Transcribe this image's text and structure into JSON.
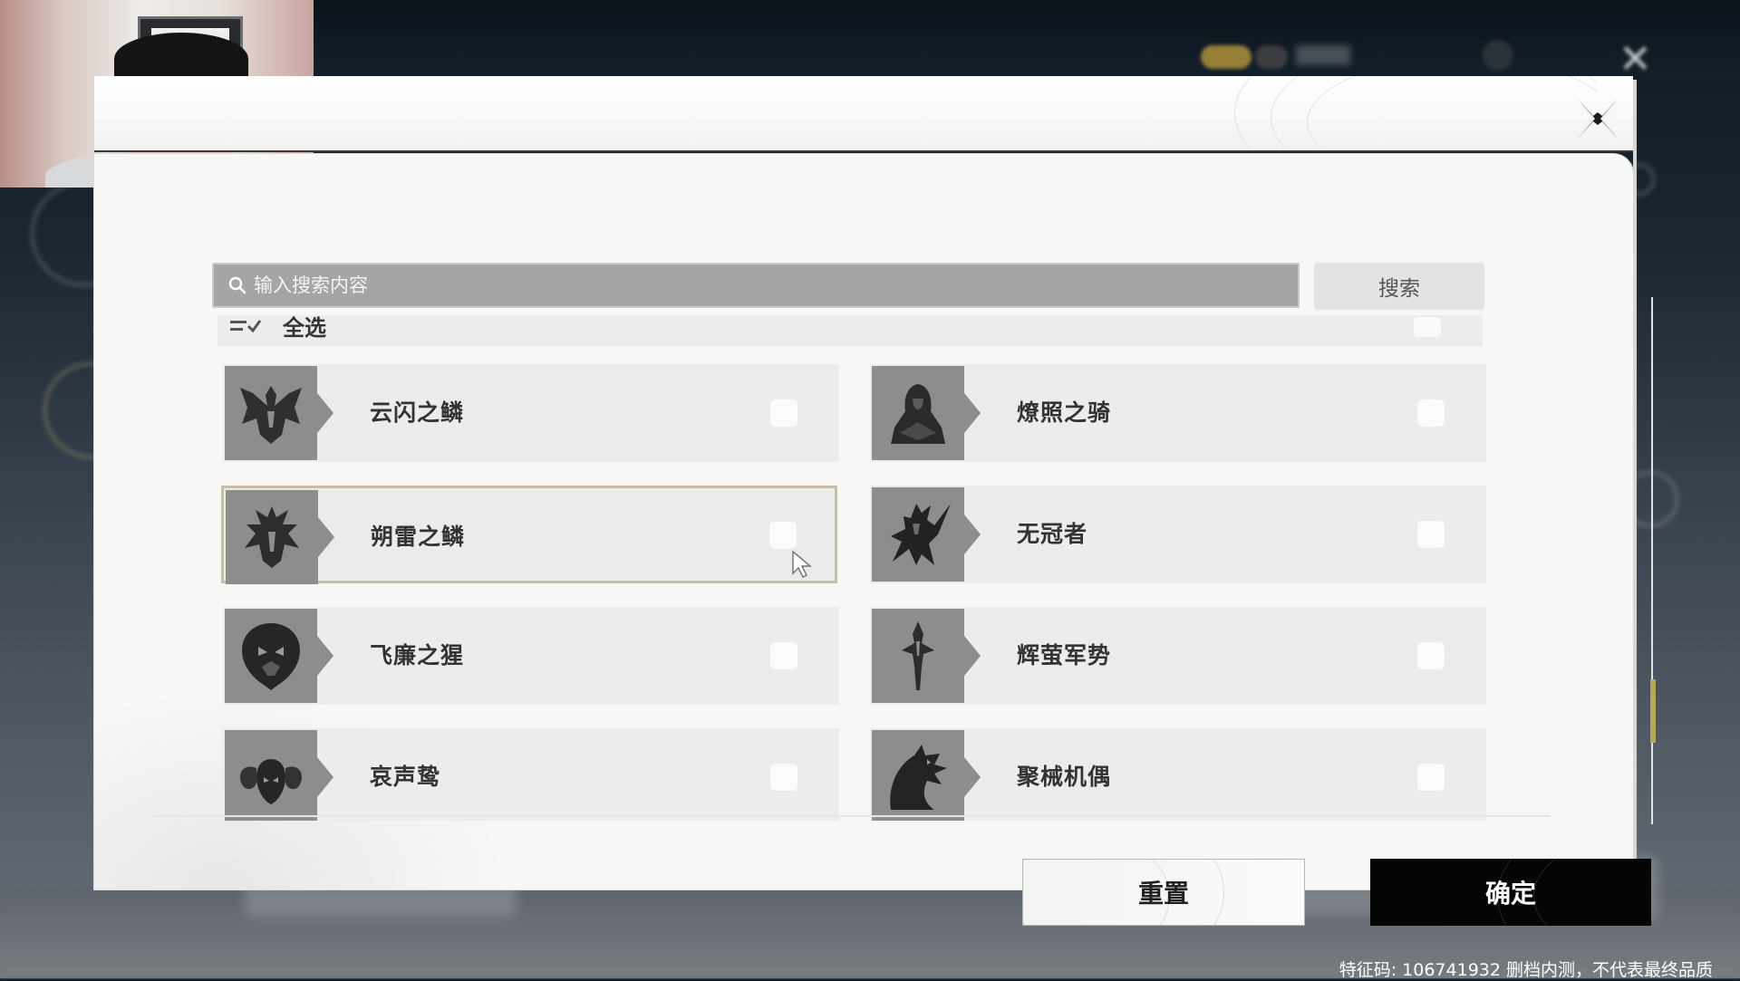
{
  "search": {
    "placeholder": "输入搜索内容",
    "button_label": "搜索"
  },
  "list": {
    "select_all_label": "全选",
    "items": [
      {
        "name": "云闪之鳞",
        "icon": "winged-dragon-icon",
        "checked": false,
        "highlighted": false
      },
      {
        "name": "燎照之骑",
        "icon": "hooded-knight-icon",
        "checked": false,
        "highlighted": false
      },
      {
        "name": "朔雷之鳞",
        "icon": "thunder-dragon-icon",
        "checked": false,
        "highlighted": true
      },
      {
        "name": "无冠者",
        "icon": "crownless-warrior-icon",
        "checked": false,
        "highlighted": false
      },
      {
        "name": "飞廉之猩",
        "icon": "beast-head-icon",
        "checked": false,
        "highlighted": false
      },
      {
        "name": "辉萤军势",
        "icon": "firefly-army-icon",
        "checked": false,
        "highlighted": false
      },
      {
        "name": "哀声鸷",
        "icon": "ram-head-icon",
        "checked": false,
        "highlighted": false
      },
      {
        "name": "聚械机偶",
        "icon": "mech-dragon-icon",
        "checked": false,
        "highlighted": false
      }
    ]
  },
  "footer": {
    "reset_label": "重置",
    "confirm_label": "确定"
  },
  "watermark": "特征码: 106741932  删档内测，不代表最终品质",
  "colors": {
    "accent_scroll": "#b8a65a",
    "confirm_bg": "#050505",
    "card_bg": "#ececeb",
    "icon_bg": "#8d8d8c"
  }
}
